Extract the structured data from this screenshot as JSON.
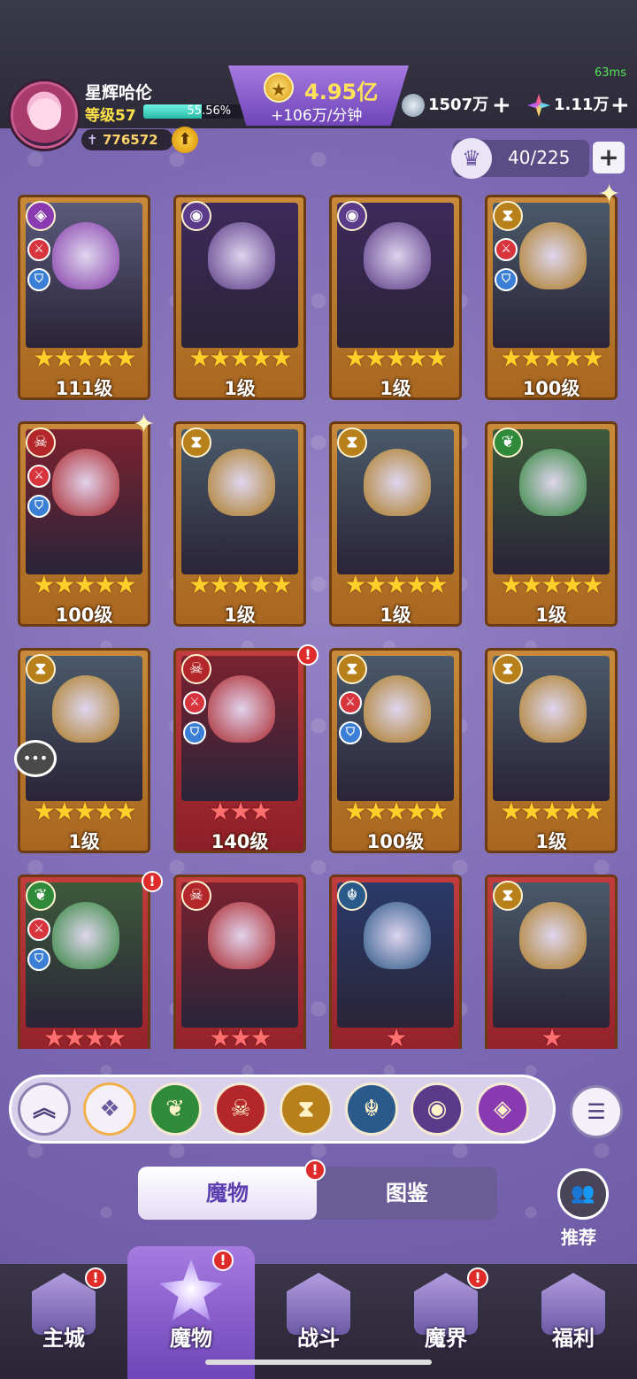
{
  "status": {
    "fps": "63ms"
  },
  "player": {
    "name": "星辉哈伦",
    "level_label": "等级57",
    "exp_percent": 55.56,
    "exp_text": "55.56%",
    "power": "776572"
  },
  "currency": {
    "gold": "4.95亿",
    "gold_rate": "+106万/分钟",
    "silver": "1507万",
    "gems": "1.11万"
  },
  "capacity": {
    "text": "40/225",
    "add_label": "+"
  },
  "colors": {
    "dark": "#5b3a8a",
    "fire": "#b3262a",
    "earth": "#2f8a3a",
    "sand": "#b8801a",
    "water": "#2a5a8a",
    "light": "#8a3ab0"
  },
  "cards": [
    {
      "element": "light",
      "glyph": "◈",
      "atk": true,
      "def": true,
      "stars": 5,
      "star_type": "gold",
      "frame": "gold",
      "level": "111级"
    },
    {
      "element": "dark",
      "glyph": "◉",
      "atk": false,
      "def": false,
      "stars": 5,
      "star_type": "gold",
      "frame": "gold",
      "level": "1级"
    },
    {
      "element": "dark",
      "glyph": "◉",
      "atk": false,
      "def": false,
      "stars": 5,
      "star_type": "gold",
      "frame": "gold",
      "level": "1级"
    },
    {
      "element": "sand",
      "glyph": "⧗",
      "atk": true,
      "def": true,
      "stars": 5,
      "star_type": "gold",
      "frame": "gold",
      "level": "100级"
    },
    {
      "element": "fire",
      "glyph": "☠",
      "atk": true,
      "def": true,
      "stars": 5,
      "star_type": "gold",
      "frame": "gold",
      "level": "100级"
    },
    {
      "element": "sand",
      "glyph": "⧗",
      "atk": false,
      "def": false,
      "stars": 5,
      "star_type": "gold",
      "frame": "gold",
      "level": "1级"
    },
    {
      "element": "sand",
      "glyph": "⧗",
      "atk": false,
      "def": false,
      "stars": 5,
      "star_type": "gold",
      "frame": "gold",
      "level": "1级"
    },
    {
      "element": "earth",
      "glyph": "❦",
      "atk": false,
      "def": false,
      "stars": 5,
      "star_type": "gold",
      "frame": "gold",
      "level": "1级"
    },
    {
      "element": "sand",
      "glyph": "⧗",
      "atk": false,
      "def": false,
      "stars": 5,
      "star_type": "gold",
      "frame": "gold",
      "level": "1级"
    },
    {
      "element": "fire",
      "glyph": "☠",
      "atk": true,
      "def": true,
      "stars": 3,
      "star_type": "red",
      "frame": "red",
      "level": "140级"
    },
    {
      "element": "sand",
      "glyph": "⧗",
      "atk": true,
      "def": true,
      "stars": 5,
      "star_type": "gold",
      "frame": "gold",
      "level": "100级"
    },
    {
      "element": "sand",
      "glyph": "⧗",
      "atk": false,
      "def": false,
      "stars": 5,
      "star_type": "gold",
      "frame": "gold",
      "level": "1级"
    },
    {
      "element": "earth",
      "glyph": "❦",
      "atk": true,
      "def": true,
      "stars": 4,
      "star_type": "red",
      "frame": "red",
      "level": ""
    },
    {
      "element": "fire",
      "glyph": "☠",
      "atk": false,
      "def": false,
      "stars": 3,
      "star_type": "red",
      "frame": "red",
      "level": ""
    },
    {
      "element": "water",
      "glyph": "☬",
      "atk": false,
      "def": false,
      "stars": 1,
      "star_type": "red",
      "frame": "red",
      "level": ""
    },
    {
      "element": "sand",
      "glyph": "⧗",
      "atk": false,
      "def": false,
      "stars": 1,
      "star_type": "red",
      "frame": "red",
      "level": ""
    }
  ],
  "filters": [
    {
      "name": "earth",
      "glyph": "❦"
    },
    {
      "name": "fire",
      "glyph": "☠"
    },
    {
      "name": "sand",
      "glyph": "⧗"
    },
    {
      "name": "water",
      "glyph": "☬"
    },
    {
      "name": "dark",
      "glyph": "◉"
    },
    {
      "name": "light",
      "glyph": "◈"
    }
  ],
  "tabs": {
    "monster": "魔物",
    "codex": "图鉴"
  },
  "recommend_label": "推荐",
  "nav": [
    {
      "label": "主城",
      "alert": true,
      "active": false
    },
    {
      "label": "魔物",
      "alert": true,
      "active": true
    },
    {
      "label": "战斗",
      "alert": false,
      "active": false
    },
    {
      "label": "魔界",
      "alert": true,
      "active": false
    },
    {
      "label": "福利",
      "alert": false,
      "active": false
    }
  ]
}
